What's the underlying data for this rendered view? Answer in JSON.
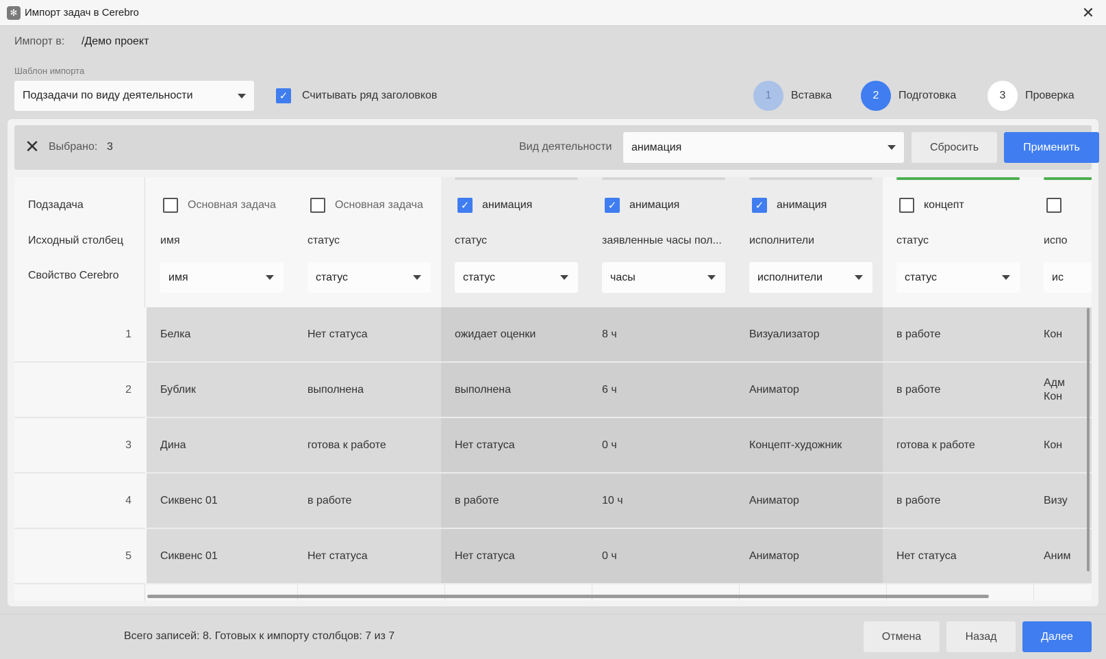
{
  "window": {
    "title": "Импорт задач в Cerebro"
  },
  "import_to": {
    "label": "Импорт в:",
    "value": "/Демо проект"
  },
  "template": {
    "label": "Шаблон импорта",
    "value": "Подзадачи по виду деятельности"
  },
  "read_headers": {
    "label": "Считывать ряд заголовков",
    "checked": true
  },
  "steps": [
    {
      "number": "1",
      "label": "Вставка"
    },
    {
      "number": "2",
      "label": "Подготовка"
    },
    {
      "number": "3",
      "label": "Проверка"
    }
  ],
  "selection": {
    "selected_label": "Выбрано:",
    "selected_count": "3",
    "activity_label": "Вид деятельности",
    "activity_value": "анимация",
    "reset_label": "Сбросить",
    "apply_label": "Применить"
  },
  "row_labels": {
    "subtask": "Подзадача",
    "source_column": "Исходный столбец",
    "property": "Свойство Cerebro"
  },
  "row_numbers": [
    "1",
    "2",
    "3",
    "4",
    "5"
  ],
  "columns": [
    {
      "subtask": "Основная задача",
      "checked": false,
      "source": "имя",
      "property": "имя",
      "cells": [
        "Белка",
        "Бублик",
        "Дина",
        "Сиквенс 01",
        "Сиквенс 01"
      ]
    },
    {
      "subtask": "Основная задача",
      "checked": false,
      "source": "статус",
      "property": "статус",
      "cells": [
        "Нет статуса",
        "выполнена",
        "готова к работе",
        "в работе",
        "Нет статуса"
      ]
    },
    {
      "subtask": "анимация",
      "checked": true,
      "source": "статус",
      "property": "статус",
      "cells": [
        "ожидает оценки",
        "выполнена",
        "Нет статуса",
        "в работе",
        "Нет статуса"
      ]
    },
    {
      "subtask": "анимация",
      "checked": true,
      "source": "заявленные часы пол...",
      "property": "часы",
      "cells": [
        "8 ч",
        "6 ч",
        "0 ч",
        "10 ч",
        "0 ч"
      ]
    },
    {
      "subtask": "анимация",
      "checked": true,
      "source": "исполнители",
      "property": "исполнители",
      "cells": [
        "Визуализатор",
        "Аниматор",
        "Концепт-художник",
        "Аниматор",
        "Аниматор"
      ]
    },
    {
      "subtask": "концепт",
      "checked": false,
      "source": "статус",
      "property": "статус",
      "cells": [
        "в работе",
        "в работе",
        "готова к работе",
        "в работе",
        "Нет статуса"
      ]
    },
    {
      "subtask": "",
      "checked": false,
      "source": "испо",
      "property": "ис",
      "cells": [
        "Кон",
        "Адм\nКон",
        "Кон",
        "Визу",
        "Аним"
      ]
    }
  ],
  "footer": {
    "summary": "Всего записей: 8. Готовых к импорту столбцов: 7 из 7",
    "cancel_label": "Отмена",
    "back_label": "Назад",
    "next_label": "Далее"
  }
}
